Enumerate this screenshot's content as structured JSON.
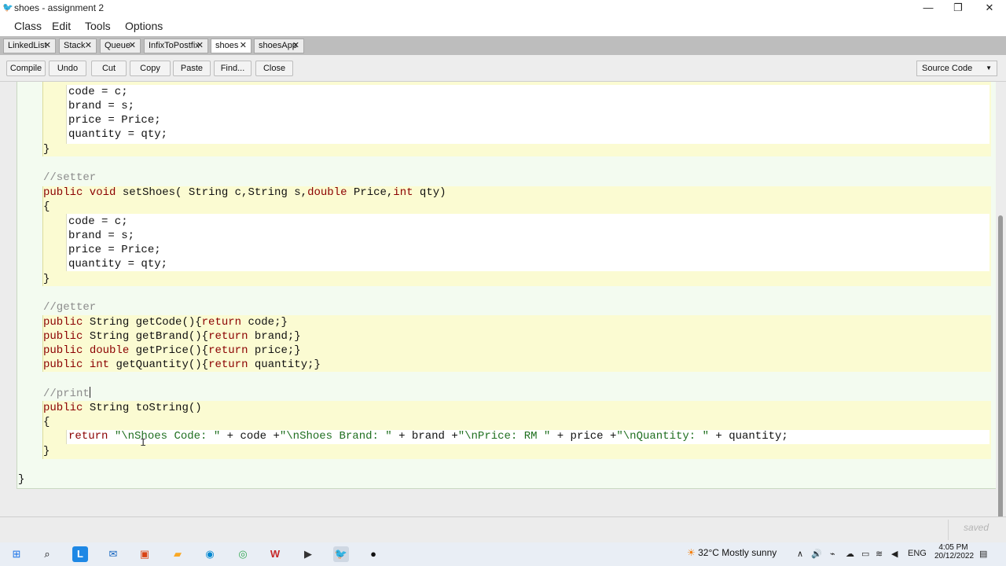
{
  "window": {
    "title": "shoes - assignment 2",
    "minimize": "—",
    "restore": "❐",
    "close": "✕"
  },
  "menu": [
    "Class",
    "Edit",
    "Tools",
    "Options"
  ],
  "tabs": [
    {
      "label": "LinkedList",
      "active": false
    },
    {
      "label": "Stack",
      "active": false
    },
    {
      "label": "Queue",
      "active": false
    },
    {
      "label": "InfixToPostfix",
      "active": false
    },
    {
      "label": "shoes",
      "active": true
    },
    {
      "label": "shoesApp",
      "active": false
    }
  ],
  "tab_close_glyph": "✕",
  "toolbar": {
    "compile": "Compile",
    "undo": "Undo",
    "cut": "Cut",
    "copy": "Copy",
    "paste": "Paste",
    "find": "Find...",
    "close": "Close",
    "view_select": "Source Code"
  },
  "code": {
    "l1": "code = c;",
    "l2": "brand = s;",
    "l3": "price = Price;",
    "l4": "quantity = qty;",
    "l5": "}",
    "c_setter": "//setter",
    "setter_sig_kw": "public void",
    "setter_sig_name": " setShoes( String c,String s,",
    "setter_double": "double",
    "setter_mid": " Price,",
    "setter_int": "int",
    "setter_end": " qty)",
    "brace_open": "{",
    "s1": "code = c;",
    "s2": "brand = s;",
    "s3": "price = Price;",
    "s4": "quantity = qty;",
    "brace_close": "}",
    "c_getter": "//getter",
    "public": "public",
    "g1_type": " String getCode(){",
    "g1_ret": "return",
    "g1_end": " code;}",
    "g2_type": " String getBrand(){",
    "g2_end": " brand;}",
    "g3_double": "double",
    "g3_name": " getPrice(){",
    "g3_end": " price;}",
    "g4_int": "int",
    "g4_name": " getQuantity(){",
    "g4_end": " quantity;}",
    "c_print": "//print",
    "ts_sig": " String toString()",
    "ret_kw": "return",
    "str1": "\"\\nShoes Code: \"",
    "op1": " + code +",
    "str2": "\"\\nShoes Brand: \"",
    "op2": " + brand +",
    "str3": "\"\\nPrice: RM \"",
    "op3": " + price +",
    "str4": "\"\\nQuantity: \"",
    "op4": " + quantity;",
    "class_close": "}"
  },
  "status": {
    "text": "saved"
  },
  "taskbar": {
    "weather": "32°C  Mostly sunny",
    "lang": "ENG",
    "time": "4:05 PM",
    "date": "20/12/2022"
  },
  "colors": {
    "keyword": "#8b0000",
    "string": "#1f6f1f",
    "comment": "#8c8c8c",
    "method_bg": "#fbfbd2",
    "class_bg": "#f3fbf0"
  }
}
